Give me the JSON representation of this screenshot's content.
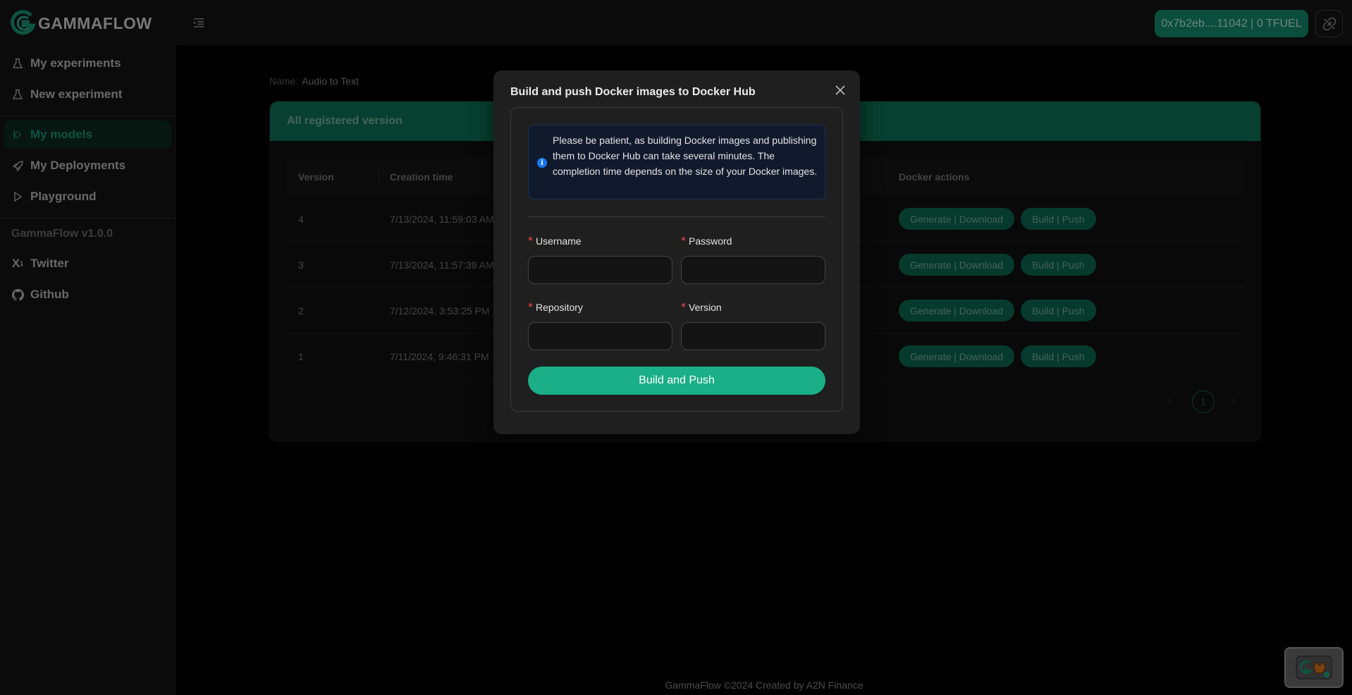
{
  "app": {
    "brand_text": "GAMMAFLOW",
    "accent_color": "#169a77"
  },
  "header": {
    "wallet_label": "0x7b2eb....11042 | 0 TFUEL",
    "menu_icon": "menu-fold-icon",
    "disconnect_icon": "link-broken-icon"
  },
  "sidebar": {
    "items": [
      {
        "label": "My experiments",
        "icon": "flask-icon"
      },
      {
        "label": "New experiment",
        "icon": "flask-icon"
      },
      {
        "label": "My models",
        "icon": "model-icon",
        "active": true
      },
      {
        "label": "My Deployments",
        "icon": "rocket-icon"
      },
      {
        "label": "Playground",
        "icon": "play-icon"
      }
    ],
    "version": "GammaFlow v1.0.0",
    "links": [
      {
        "label": "Twitter",
        "icon": "x-icon"
      },
      {
        "label": "Github",
        "icon": "github-icon"
      }
    ]
  },
  "main": {
    "name_label": "Name:",
    "name_value": "Audio to Text",
    "card_title": "All registered version",
    "columns": [
      "Version",
      "Creation time",
      "Docker actions"
    ],
    "rows": [
      {
        "version": "4",
        "created": "7/13/2024, 11:59:03 AM"
      },
      {
        "version": "3",
        "created": "7/13/2024, 11:57:39 AM"
      },
      {
        "version": "2",
        "created": "7/12/2024, 3:53:25 PM"
      },
      {
        "version": "1",
        "created": "7/11/2024, 9:46:31 PM"
      }
    ],
    "actions": {
      "generate_label": "Generate | Download",
      "build_label": "Build | Push"
    },
    "pagination": {
      "current_page": "1"
    }
  },
  "modal": {
    "title": "Build and push Docker images to Docker Hub",
    "info_text": "Please be patient, as building Docker images and publishing them to Docker Hub can take several minutes. The completion time depends on the size of your Docker images.",
    "fields": {
      "username_label": "Username",
      "password_label": "Password",
      "repository_label": "Repository",
      "version_label": "Version",
      "username_value": "",
      "password_value": "",
      "repository_value": "",
      "version_value": ""
    },
    "required_mark": "*",
    "submit_label": "Build and Push"
  },
  "footer": {
    "text": "GammaFlow ©2024 Created by A2N Finance"
  }
}
